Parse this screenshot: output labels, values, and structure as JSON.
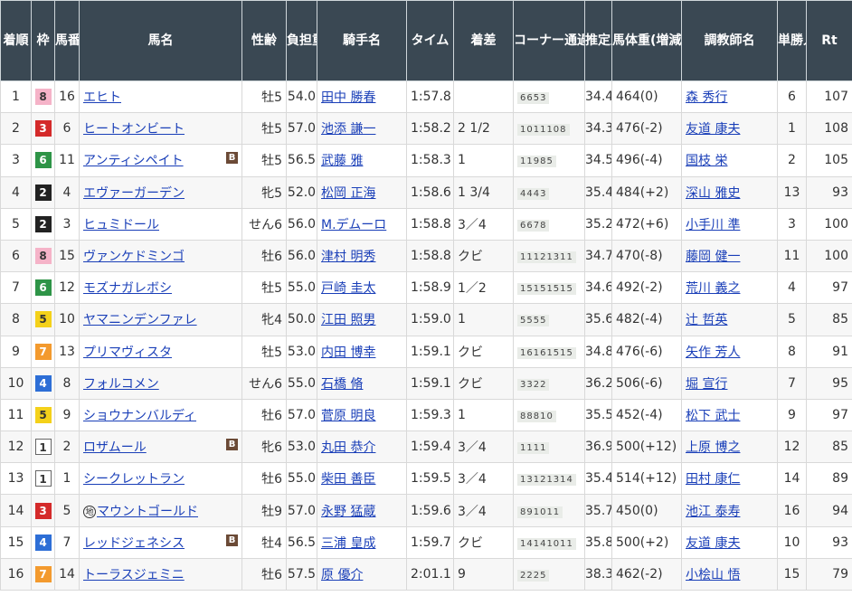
{
  "headers": [
    "着順",
    "枠",
    "馬番",
    "馬名",
    "性齢",
    "負担重量",
    "騎手名",
    "タイム",
    "着差",
    "コーナー通過順位",
    "推定上り",
    "馬体重(増減)",
    "調教師名",
    "単勝人気",
    "Rt"
  ],
  "rows": [
    {
      "pos": "1",
      "waku": "8",
      "num": "16",
      "horse": "エヒト",
      "chi": "",
      "blink": "",
      "sexage": "牡5",
      "weight": "54.0",
      "jockey": "田中 勝春",
      "time": "1:57.8",
      "margin": "",
      "corner": "6653",
      "last3f": "34.4",
      "bw": "464(0)",
      "trainer": "森 秀行",
      "pop": "6",
      "rt": "107"
    },
    {
      "pos": "2",
      "waku": "3",
      "num": "6",
      "horse": "ヒートオンビート",
      "chi": "",
      "blink": "",
      "sexage": "牡5",
      "weight": "57.0",
      "jockey": "池添 謙一",
      "time": "1:58.2",
      "margin": "2 1/2",
      "corner": "1011108",
      "last3f": "34.3",
      "bw": "476(-2)",
      "trainer": "友道 康夫",
      "pop": "1",
      "rt": "108"
    },
    {
      "pos": "3",
      "waku": "6",
      "num": "11",
      "horse": "アンティシペイト",
      "chi": "",
      "blink": "B",
      "sexage": "牡5",
      "weight": "56.5",
      "jockey": "武藤 雅",
      "time": "1:58.3",
      "margin": "1",
      "corner": "11985",
      "last3f": "34.5",
      "bw": "496(-4)",
      "trainer": "国枝 栄",
      "pop": "2",
      "rt": "105"
    },
    {
      "pos": "4",
      "waku": "2",
      "num": "4",
      "horse": "エヴァーガーデン",
      "chi": "",
      "blink": "",
      "sexage": "牝5",
      "weight": "52.0",
      "jockey": "松岡 正海",
      "time": "1:58.6",
      "margin": "1 3/4",
      "corner": "4443",
      "last3f": "35.4",
      "bw": "484(+2)",
      "trainer": "深山 雅史",
      "pop": "13",
      "rt": "93"
    },
    {
      "pos": "5",
      "waku": "2",
      "num": "3",
      "horse": "ヒュミドール",
      "chi": "",
      "blink": "",
      "sexage": "せん6",
      "weight": "56.0",
      "jockey": "M.デムーロ",
      "time": "1:58.8",
      "margin": "3／4",
      "corner": "6678",
      "last3f": "35.2",
      "bw": "472(+6)",
      "trainer": "小手川 準",
      "pop": "3",
      "rt": "100"
    },
    {
      "pos": "6",
      "waku": "8",
      "num": "15",
      "horse": "ヴァンケドミンゴ",
      "chi": "",
      "blink": "",
      "sexage": "牡6",
      "weight": "56.0",
      "jockey": "津村 明秀",
      "time": "1:58.8",
      "margin": "クビ",
      "corner": "11121311",
      "last3f": "34.7",
      "bw": "470(-8)",
      "trainer": "藤岡 健一",
      "pop": "11",
      "rt": "100"
    },
    {
      "pos": "7",
      "waku": "6",
      "num": "12",
      "horse": "モズナガレボシ",
      "chi": "",
      "blink": "",
      "sexage": "牡5",
      "weight": "55.0",
      "jockey": "戸崎 圭太",
      "time": "1:58.9",
      "margin": "1／2",
      "corner": "15151515",
      "last3f": "34.6",
      "bw": "492(-2)",
      "trainer": "荒川 義之",
      "pop": "4",
      "rt": "97"
    },
    {
      "pos": "8",
      "waku": "5",
      "num": "10",
      "horse": "ヤマニンデンファレ",
      "chi": "",
      "blink": "",
      "sexage": "牝4",
      "weight": "50.0",
      "jockey": "江田 照男",
      "time": "1:59.0",
      "margin": "1",
      "corner": "5555",
      "last3f": "35.6",
      "bw": "482(-4)",
      "trainer": "辻 哲英",
      "pop": "5",
      "rt": "85"
    },
    {
      "pos": "9",
      "waku": "7",
      "num": "13",
      "horse": "プリマヴィスタ",
      "chi": "",
      "blink": "",
      "sexage": "牡5",
      "weight": "53.0",
      "jockey": "内田 博幸",
      "time": "1:59.1",
      "margin": "クビ",
      "corner": "16161515",
      "last3f": "34.8",
      "bw": "476(-6)",
      "trainer": "矢作 芳人",
      "pop": "8",
      "rt": "91"
    },
    {
      "pos": "10",
      "waku": "4",
      "num": "8",
      "horse": "フォルコメン",
      "chi": "",
      "blink": "",
      "sexage": "せん6",
      "weight": "55.0",
      "jockey": "石橋 脩",
      "time": "1:59.1",
      "margin": "クビ",
      "corner": "3322",
      "last3f": "36.2",
      "bw": "506(-6)",
      "trainer": "堀 宣行",
      "pop": "7",
      "rt": "95"
    },
    {
      "pos": "11",
      "waku": "5",
      "num": "9",
      "horse": "ショウナンバルディ",
      "chi": "",
      "blink": "",
      "sexage": "牡6",
      "weight": "57.0",
      "jockey": "菅原 明良",
      "time": "1:59.3",
      "margin": "1",
      "corner": "88810",
      "last3f": "35.5",
      "bw": "452(-4)",
      "trainer": "松下 武士",
      "pop": "9",
      "rt": "97"
    },
    {
      "pos": "12",
      "waku": "1",
      "num": "2",
      "horse": "ロザムール",
      "chi": "",
      "blink": "B",
      "sexage": "牝6",
      "weight": "53.0",
      "jockey": "丸田 恭介",
      "time": "1:59.4",
      "margin": "3／4",
      "corner": "1111",
      "last3f": "36.9",
      "bw": "500(+12)",
      "trainer": "上原 博之",
      "pop": "12",
      "rt": "85"
    },
    {
      "pos": "13",
      "waku": "1",
      "num": "1",
      "horse": "シークレットラン",
      "chi": "",
      "blink": "",
      "sexage": "牡6",
      "weight": "55.0",
      "jockey": "柴田 善臣",
      "time": "1:59.5",
      "margin": "3／4",
      "corner": "13121314",
      "last3f": "35.4",
      "bw": "514(+12)",
      "trainer": "田村 康仁",
      "pop": "14",
      "rt": "89"
    },
    {
      "pos": "14",
      "waku": "3",
      "num": "5",
      "horse": "マウントゴールド",
      "chi": "地",
      "blink": "",
      "sexage": "牡9",
      "weight": "57.0",
      "jockey": "永野 猛蔵",
      "time": "1:59.6",
      "margin": "3／4",
      "corner": "891011",
      "last3f": "35.7",
      "bw": "450(0)",
      "trainer": "池江 泰寿",
      "pop": "16",
      "rt": "94"
    },
    {
      "pos": "15",
      "waku": "4",
      "num": "7",
      "horse": "レッドジェネシス",
      "chi": "",
      "blink": "B",
      "sexage": "牡4",
      "weight": "56.5",
      "jockey": "三浦 皇成",
      "time": "1:59.7",
      "margin": "クビ",
      "corner": "14141011",
      "last3f": "35.8",
      "bw": "500(+2)",
      "trainer": "友道 康夫",
      "pop": "10",
      "rt": "93"
    },
    {
      "pos": "16",
      "waku": "7",
      "num": "14",
      "horse": "トーラスジェミニ",
      "chi": "",
      "blink": "",
      "sexage": "牡6",
      "weight": "57.5",
      "jockey": "原 優介",
      "time": "2:01.1",
      "margin": "9",
      "corner": "2225",
      "last3f": "38.3",
      "bw": "462(-2)",
      "trainer": "小桧山 悟",
      "pop": "15",
      "rt": "79"
    }
  ]
}
